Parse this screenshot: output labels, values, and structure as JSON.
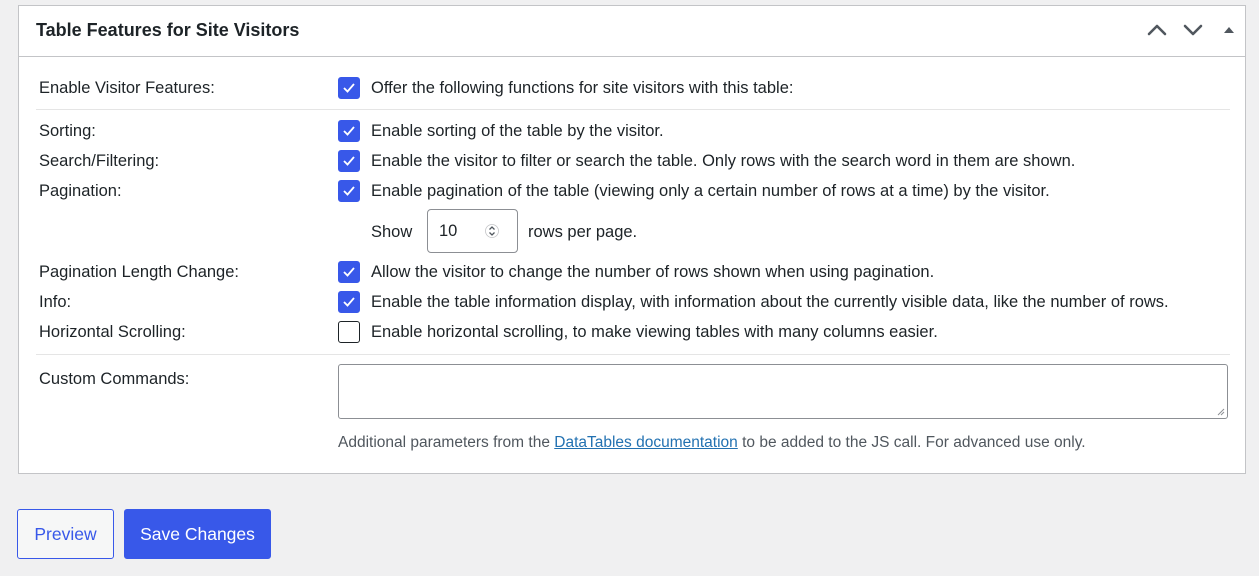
{
  "panel": {
    "title": "Table Features for Site Visitors",
    "move_up_icon": "chevron-up-icon",
    "move_down_icon": "chevron-down-icon",
    "toggle_icon": "triangle-up-icon"
  },
  "features": [
    {
      "label": "Enable Visitor Features:",
      "checked": true,
      "description": "Offer the following functions for site visitors with this table:"
    },
    {
      "label": "Sorting:",
      "checked": true,
      "description": "Enable sorting of the table by the visitor."
    },
    {
      "label": "Search/Filtering:",
      "checked": true,
      "description": "Enable the visitor to filter or search the table. Only rows with the search word in them are shown."
    },
    {
      "label": "Pagination:",
      "checked": true,
      "description": "Enable pagination of the table (viewing only a certain number of rows at a time) by the visitor."
    },
    {
      "label": "Pagination Length Change:",
      "checked": true,
      "description": "Allow the visitor to change the number of rows shown when using pagination."
    },
    {
      "label": "Info:",
      "checked": true,
      "description": "Enable the table information display, with information about the currently visible data, like the number of rows."
    },
    {
      "label": "Horizontal Scrolling:",
      "checked": false,
      "description": "Enable horizontal scrolling, to make viewing tables with many columns easier."
    }
  ],
  "pagination_rows": {
    "show_label": "Show",
    "value": "10",
    "suffix": "rows per page."
  },
  "custom_commands": {
    "label": "Custom Commands:",
    "value": "",
    "help_before": "Additional parameters from the ",
    "help_link": "DataTables documentation",
    "help_after": " to be added to the JS call. For advanced use only."
  },
  "buttons": {
    "preview": "Preview",
    "save": "Save Changes"
  },
  "colors": {
    "accent": "#3858e9",
    "link": "#2271b1",
    "background": "#f0f0f1"
  }
}
